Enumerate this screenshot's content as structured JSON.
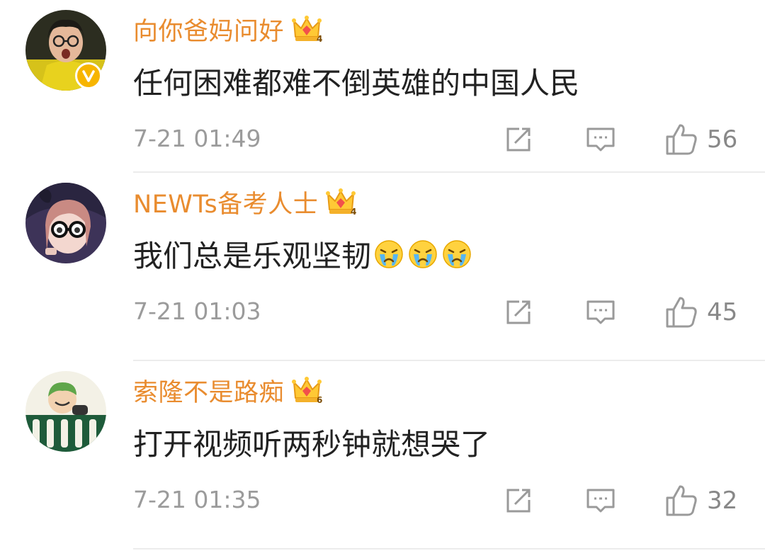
{
  "comments": [
    {
      "username": "向你爸妈问好",
      "level": "4",
      "text": "任何困难都难不倒英雄的中国人民",
      "emojis": [],
      "time": "7-21 01:49",
      "likes": "56",
      "verified": true,
      "avatar_icon": "avatar-girl-glasses"
    },
    {
      "username": "NEWTs备考人士",
      "level": "4",
      "text": "我们总是乐观坚韧",
      "emojis": [
        "crying-emoji",
        "crying-emoji",
        "crying-emoji"
      ],
      "time": "7-21 01:03",
      "likes": "45",
      "verified": false,
      "avatar_icon": "avatar-anime-girl"
    },
    {
      "username": "索隆不是路痴",
      "level": "6",
      "text": "打开视频听两秒钟就想哭了",
      "emojis": [],
      "time": "7-21 01:35",
      "likes": "32",
      "verified": false,
      "avatar_icon": "avatar-zoro"
    }
  ],
  "colors": {
    "username": "#e98c2f",
    "meta": "#9b9b9b",
    "verified_badge": "#f7b500",
    "divider": "#ececec"
  },
  "icons": {
    "share": "share-icon",
    "reply": "comment-icon",
    "like": "thumbs-up-icon",
    "crown": "vip-crown-icon"
  }
}
